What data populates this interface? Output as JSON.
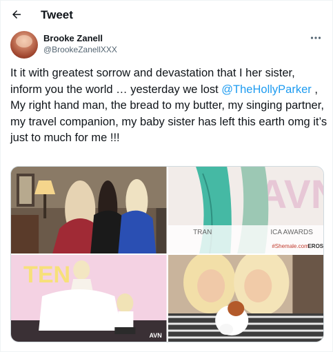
{
  "header": {
    "title": "Tweet",
    "back_icon": "arrow-left-icon"
  },
  "author": {
    "name": "Brooke Zanell",
    "handle": "@BrookeZanellXXX",
    "more_icon": "more-horizontal-icon"
  },
  "tweet": {
    "text_before_mention": "It it with greatest sorrow and devastation that I her sister, inform you the world … yesterday we lost ",
    "mention": "@TheHollyParker",
    "text_after_mention": " , My right hand man, the bread to my butter, my singing partner, my travel companion, my baby sister has left this earth omg it’s just to much for me !!!"
  },
  "media": {
    "photo_2_banner_left": "TRAN",
    "photo_2_banner_right": "ICA AWARDS",
    "photo_2_sponsor": "#Shemale.com",
    "photo_2_sponsor_2": "EROS",
    "photo_3_sign": "TEN",
    "photo_3_corner": "AVN"
  },
  "colors": {
    "accent": "#1d9bf0",
    "text": "#0f1419",
    "secondary": "#536471",
    "border": "#cfd9de"
  }
}
